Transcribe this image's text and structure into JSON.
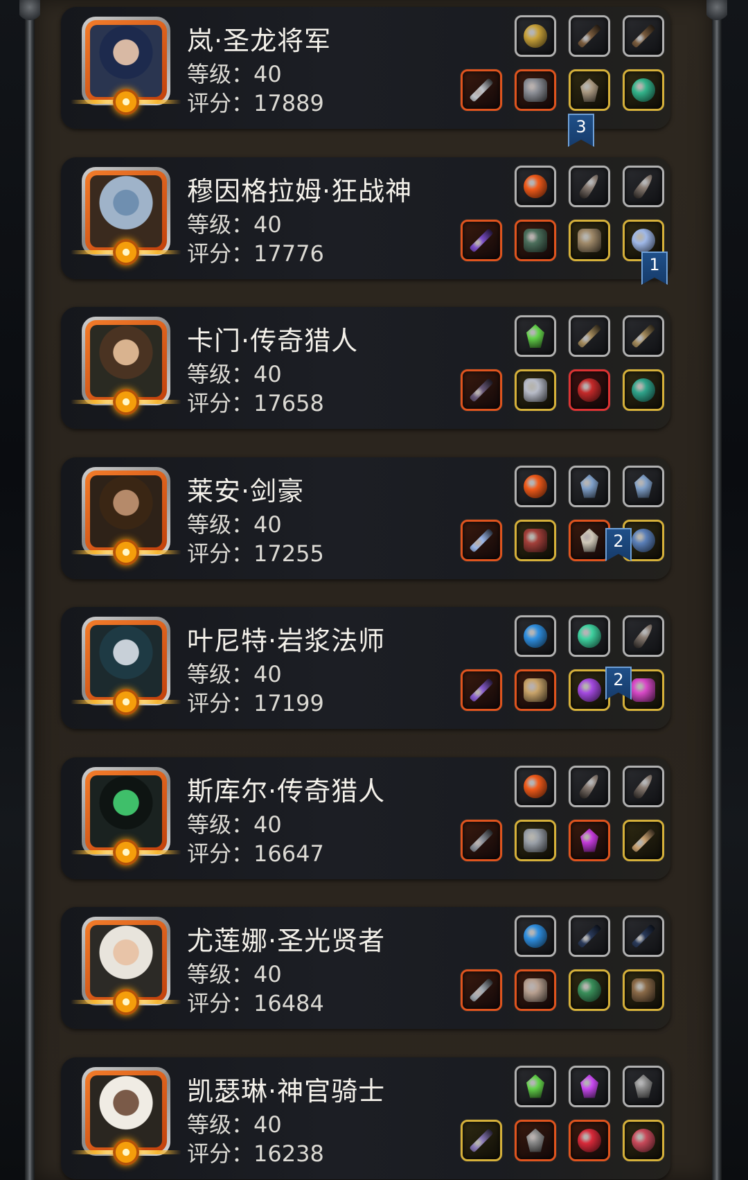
{
  "labels": {
    "level_prefix": "等级：",
    "score_prefix": "评分："
  },
  "heroes": [
    {
      "name": "岚·圣龙将军",
      "level": "40",
      "score": "17889",
      "portrait": {
        "bg": "#2a3550",
        "hair": "#1d2a4d",
        "skin": "#d8b9a4"
      },
      "top_items": [
        {
          "icon": "golden-helm-icon",
          "frame": "gray",
          "color": "#c9a23a",
          "shape": "round"
        },
        {
          "icon": "bracer-icon",
          "frame": "gray",
          "color": "#7a5c3e",
          "shape": "blade"
        },
        {
          "icon": "bracer-icon",
          "frame": "gray",
          "color": "#7a5c3e",
          "shape": "blade"
        }
      ],
      "bottom_items": [
        {
          "icon": "greatsword-icon",
          "frame": "orange",
          "color": "#bfc3c8",
          "shape": "blade"
        },
        {
          "icon": "chest-armor-icon",
          "frame": "orange",
          "color": "#8c8f96",
          "shape": "square"
        },
        {
          "icon": "winged-helm-icon",
          "frame": "gold",
          "color": "#a99880",
          "shape": "gem"
        },
        {
          "icon": "ring-icon",
          "frame": "gold",
          "color": "#33b38a",
          "shape": "round"
        }
      ]
    },
    {
      "name": "穆因格拉姆·狂战神",
      "level": "40",
      "score": "17776",
      "portrait": {
        "bg": "#3a2a1e",
        "hair": "#9fb3c9",
        "skin": "#6f8fb0"
      },
      "top_items": [
        {
          "icon": "fire-rune-icon",
          "frame": "gray",
          "color": "#f05a1a",
          "shape": "round"
        },
        {
          "icon": "feather-icon",
          "frame": "gray",
          "color": "#8a7d74",
          "shape": "feather"
        },
        {
          "icon": "feather-icon",
          "frame": "gray",
          "color": "#8a7d74",
          "shape": "feather"
        }
      ],
      "bottom_items": [
        {
          "icon": "axe-icon",
          "frame": "orange",
          "color": "#7c4fc9",
          "shape": "blade"
        },
        {
          "icon": "chest-armor-icon",
          "frame": "orange",
          "color": "#4c6f5c",
          "shape": "square"
        },
        {
          "icon": "gauntlet-icon",
          "frame": "gold",
          "color": "#a08a6a",
          "shape": "square"
        },
        {
          "icon": "amulet-icon",
          "frame": "gold",
          "color": "#9fb8e8",
          "shape": "round"
        }
      ]
    },
    {
      "name": "卡门·传奇猎人",
      "level": "40",
      "score": "17658",
      "portrait": {
        "bg": "#2a2a22",
        "hair": "#4a3322",
        "skin": "#d9b38f"
      },
      "top_items": [
        {
          "icon": "green-crystal-icon",
          "frame": "gray",
          "color": "#63d14a",
          "shape": "gem"
        },
        {
          "icon": "staff-icon",
          "frame": "gray",
          "color": "#a38a5c",
          "shape": "blade"
        },
        {
          "icon": "staff-icon",
          "frame": "gray",
          "color": "#a38a5c",
          "shape": "blade"
        }
      ],
      "bottom_items": [
        {
          "icon": "rifle-icon",
          "frame": "orange",
          "color": "#6a5a7a",
          "shape": "blade"
        },
        {
          "icon": "chest-armor-icon",
          "frame": "gold",
          "color": "#b8bcc8",
          "shape": "square"
        },
        {
          "icon": "red-eye-icon",
          "frame": "red",
          "color": "#c42a2a",
          "shape": "round"
        },
        {
          "icon": "ring-icon",
          "frame": "gold",
          "color": "#2fa38a",
          "shape": "round"
        }
      ]
    },
    {
      "name": "莱安·剑豪",
      "level": "40",
      "score": "17255",
      "portrait": {
        "bg": "#2e2218",
        "hair": "#3a2614",
        "skin": "#b58a6a"
      },
      "top_items": [
        {
          "icon": "fire-rune-icon",
          "frame": "gray",
          "color": "#f05a1a",
          "shape": "round"
        },
        {
          "icon": "lightning-shield-icon",
          "frame": "gray",
          "color": "#7f9fc8",
          "shape": "gem"
        },
        {
          "icon": "lightning-shield-icon",
          "frame": "gray",
          "color": "#7f9fc8",
          "shape": "gem"
        }
      ],
      "bottom_items": [
        {
          "icon": "sword-icon",
          "frame": "orange",
          "color": "#9ab6e8",
          "shape": "blade"
        },
        {
          "icon": "chest-armor-icon",
          "frame": "gold",
          "color": "#a3403a",
          "shape": "square"
        },
        {
          "icon": "winged-helm-icon",
          "frame": "orange",
          "color": "#d0c8b8",
          "shape": "gem"
        },
        {
          "icon": "pendant-icon",
          "frame": "gold",
          "color": "#5a7fb8",
          "shape": "round"
        }
      ]
    },
    {
      "name": "叶尼特·岩浆法师",
      "level": "40",
      "score": "17199",
      "portrait": {
        "bg": "#1c2a2e",
        "hair": "#1e3a44",
        "skin": "#c8d0d8"
      },
      "top_items": [
        {
          "icon": "blue-orb-icon",
          "frame": "gray",
          "color": "#2f8fe0",
          "shape": "round"
        },
        {
          "icon": "jade-stone-icon",
          "frame": "gray",
          "color": "#3fd2a0",
          "shape": "round"
        },
        {
          "icon": "feather-icon",
          "frame": "gray",
          "color": "#8a7d74",
          "shape": "feather"
        }
      ],
      "bottom_items": [
        {
          "icon": "magic-staff-icon",
          "frame": "orange",
          "color": "#8a5fd0",
          "shape": "blade"
        },
        {
          "icon": "robe-icon",
          "frame": "orange",
          "color": "#c9a46a",
          "shape": "square"
        },
        {
          "icon": "purple-gem-icon",
          "frame": "gold",
          "color": "#a44ae0",
          "shape": "round"
        },
        {
          "icon": "spellbook-icon",
          "frame": "gold",
          "color": "#d94ac8",
          "shape": "square"
        }
      ]
    },
    {
      "name": "斯库尔·传奇猎人",
      "level": "40",
      "score": "16647",
      "portrait": {
        "bg": "#1a2220",
        "hair": "#0e1412",
        "skin": "#3fbf6a"
      },
      "top_items": [
        {
          "icon": "fire-rune-icon",
          "frame": "gray",
          "color": "#f05a1a",
          "shape": "round"
        },
        {
          "icon": "feather-icon",
          "frame": "gray",
          "color": "#8a7d74",
          "shape": "feather"
        },
        {
          "icon": "feather-icon",
          "frame": "gray",
          "color": "#8a7d74",
          "shape": "feather"
        }
      ],
      "bottom_items": [
        {
          "icon": "pistol-icon",
          "frame": "orange",
          "color": "#8a8f98",
          "shape": "blade"
        },
        {
          "icon": "chest-armor-icon",
          "frame": "gold",
          "color": "#9aa0a8",
          "shape": "square"
        },
        {
          "icon": "purple-helm-icon",
          "frame": "orange",
          "color": "#c23ad8",
          "shape": "gem"
        },
        {
          "icon": "gauntlet-icon",
          "frame": "gold",
          "color": "#c8a070",
          "shape": "blade"
        }
      ]
    },
    {
      "name": "尤莲娜·圣光贤者",
      "level": "40",
      "score": "16484",
      "portrait": {
        "bg": "#2c2a26",
        "hair": "#e8e4dc",
        "skin": "#e8c4a8"
      },
      "top_items": [
        {
          "icon": "blue-orb-icon",
          "frame": "gray",
          "color": "#2f8fe0",
          "shape": "round"
        },
        {
          "icon": "dark-blade-icon",
          "frame": "gray",
          "color": "#2a3a5a",
          "shape": "blade"
        },
        {
          "icon": "dark-blade-icon",
          "frame": "gray",
          "color": "#2a3a5a",
          "shape": "blade"
        }
      ],
      "bottom_items": [
        {
          "icon": "mace-icon",
          "frame": "orange",
          "color": "#a0a8b0",
          "shape": "blade"
        },
        {
          "icon": "chest-armor-icon",
          "frame": "orange",
          "color": "#b8a090",
          "shape": "square"
        },
        {
          "icon": "green-orb-icon",
          "frame": "gold",
          "color": "#3a8f5a",
          "shape": "round"
        },
        {
          "icon": "skull-mask-icon",
          "frame": "gold",
          "color": "#8a6a48",
          "shape": "square"
        }
      ]
    },
    {
      "name": "凯瑟琳·神官骑士",
      "level": "40",
      "score": "16238",
      "portrait": {
        "bg": "#2a2620",
        "hair": "#f0ece4",
        "skin": "#7a5a48"
      },
      "top_items": [
        {
          "icon": "green-crystal-icon",
          "frame": "gray",
          "color": "#63d14a",
          "shape": "gem"
        },
        {
          "icon": "purple-crystal-icon",
          "frame": "gray",
          "color": "#c84af0",
          "shape": "gem"
        },
        {
          "icon": "badge-500-icon",
          "frame": "gray",
          "color": "#8a8a8a",
          "shape": "gem"
        }
      ],
      "bottom_items": [
        {
          "icon": "scepter-icon",
          "frame": "gold",
          "color": "#8a7ab8",
          "shape": "blade"
        },
        {
          "icon": "hood-icon",
          "frame": "orange",
          "color": "#8a8a8a",
          "shape": "gem"
        },
        {
          "icon": "red-potion-icon",
          "frame": "orange",
          "color": "#d82a3a",
          "shape": "round"
        },
        {
          "icon": "heart-amulet-icon",
          "frame": "gold",
          "color": "#c84a5a",
          "shape": "round"
        }
      ]
    }
  ],
  "badges": [
    "3",
    "1",
    "2",
    "2"
  ]
}
